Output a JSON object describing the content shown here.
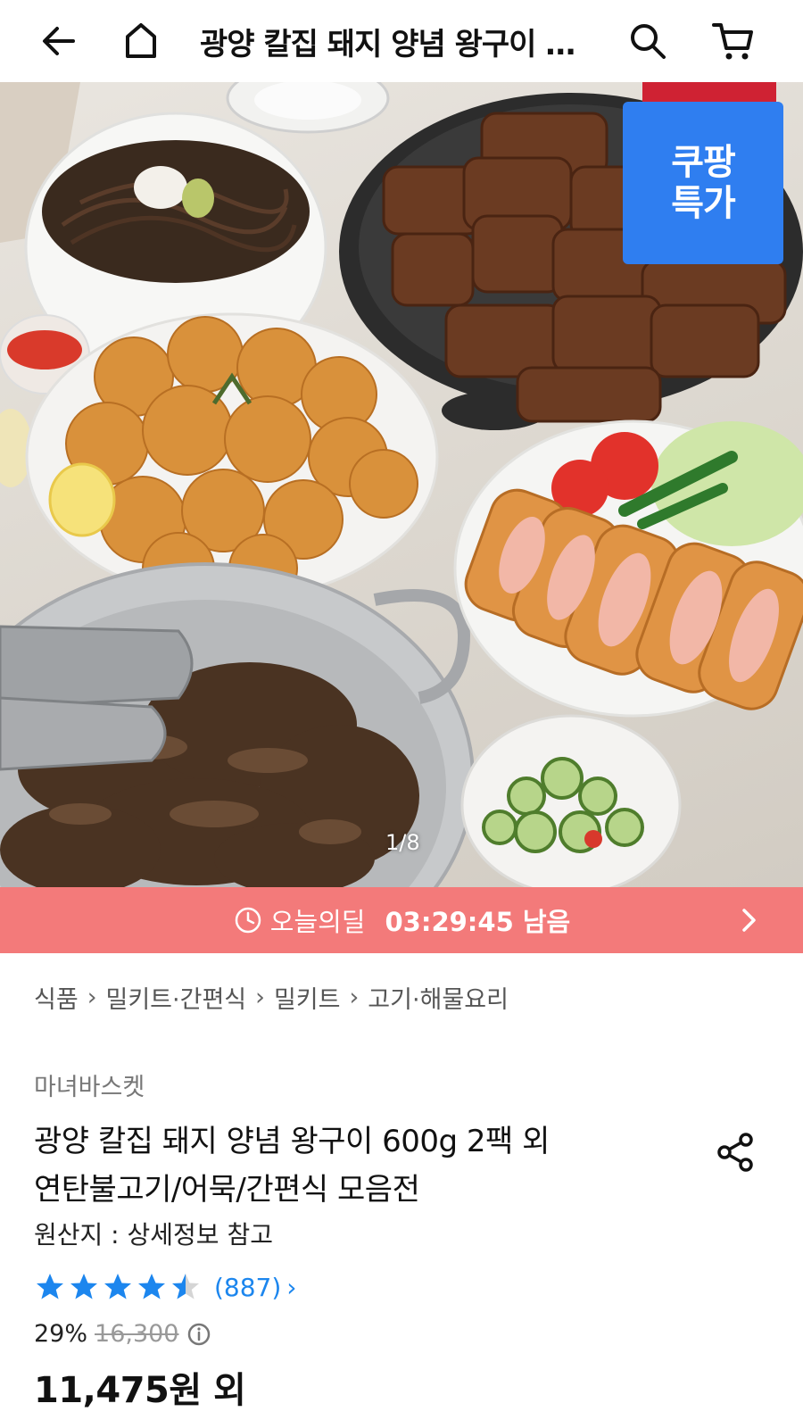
{
  "header": {
    "title": "광양 칼집 돼지 양념 왕구이 …",
    "back_icon": "back-arrow-icon",
    "home_icon": "home-icon",
    "search_icon": "search-icon",
    "cart_icon": "cart-icon"
  },
  "hero": {
    "badge_line1": "쿠팡",
    "badge_line2": "특가",
    "counter": "1/8"
  },
  "deal": {
    "label": "오늘의딜",
    "time": "03:29:45 남음"
  },
  "breadcrumb": [
    "식품",
    "밀키트·간편식",
    "밀키트",
    "고기·해물요리"
  ],
  "product": {
    "seller": "마녀바스켓",
    "title_line1": "광양 칼집 돼지 양념 왕구이 600g 2팩 외",
    "title_line2": "연탄불고기/어묵/간편식 모음전",
    "origin": "원산지 : 상세정보 참고",
    "rating": 4.5,
    "review_count": "(887)",
    "review_chevron": "›",
    "discount": "29%",
    "original_price": "16,300",
    "price": "11,475원 외"
  },
  "colors": {
    "deal_bar": "#f37a7a",
    "badge": "#2f7ef0",
    "star": "#1c86ee",
    "link": "#1c86ee"
  }
}
